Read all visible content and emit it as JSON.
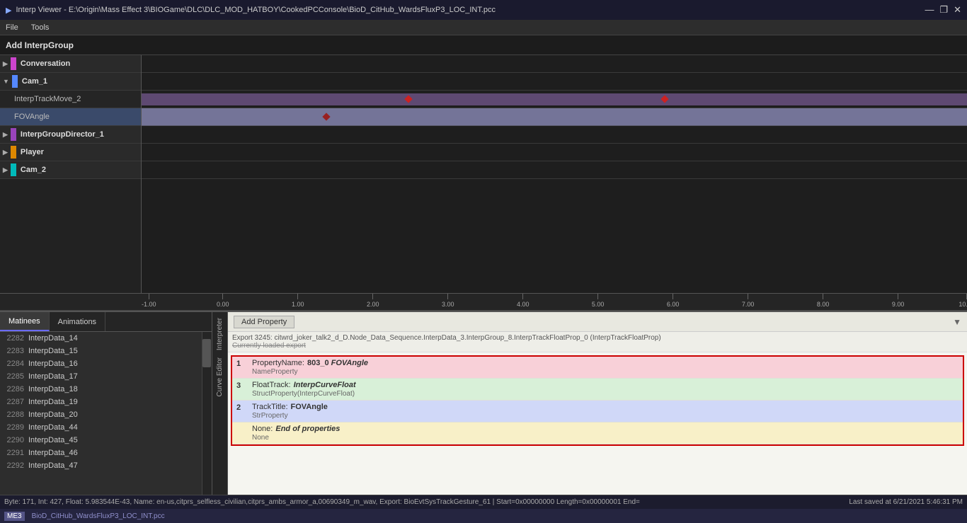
{
  "titlebar": {
    "icon": "▶",
    "title": "Interp Viewer - E:\\Origin\\Mass Effect 3\\BIOGame\\DLC\\DLC_MOD_HATBOY\\CookedPCConsole\\BioD_CitHub_WardsFluxP3_LOC_INT.pcc",
    "minimize": "—",
    "maximize": "❐",
    "close": "✕"
  },
  "menubar": {
    "items": [
      "File",
      "Tools"
    ]
  },
  "addInterpBar": {
    "label": "Add InterpGroup"
  },
  "tracks": [
    {
      "id": "conversation",
      "name": "Conversation",
      "color": "#cc44cc",
      "indent": 0,
      "arrow": "▶",
      "hasBar": false
    },
    {
      "id": "cam1",
      "name": "Cam_1",
      "color": "#5588ff",
      "indent": 0,
      "arrow": "▼",
      "hasBar": false
    },
    {
      "id": "interptrack",
      "name": "InterpTrackMove_2",
      "color": null,
      "indent": 1,
      "arrow": null,
      "hasBar": true,
      "barColor": "#6666aa",
      "keyframes": [
        0.35,
        0.72
      ]
    },
    {
      "id": "fovangle",
      "name": "FOVAngle",
      "color": null,
      "indent": 1,
      "arrow": null,
      "hasBar": true,
      "barColor": "#6666aa",
      "keyframes": [
        0.27
      ]
    },
    {
      "id": "interpgroupdir",
      "name": "InterpGroupDirector_1",
      "color": "#9944bb",
      "indent": 0,
      "arrow": "▶",
      "hasBar": false
    },
    {
      "id": "player",
      "name": "Player",
      "color": "#dd8800",
      "indent": 0,
      "arrow": "▶",
      "hasBar": false
    },
    {
      "id": "cam2",
      "name": "Cam_2",
      "color": "#00bbbb",
      "indent": 0,
      "arrow": "▶",
      "hasBar": false
    }
  ],
  "ruler": {
    "ticks": [
      "-1.00",
      "0.00",
      "1.00",
      "2.00",
      "3.00",
      "4.00",
      "5.00",
      "6.00",
      "7.00",
      "8.00",
      "9.00",
      "10.00"
    ]
  },
  "tabs": {
    "matinees": "Matinees",
    "animations": "Animations"
  },
  "listItems": [
    {
      "num": "2282",
      "name": "InterpData_14"
    },
    {
      "num": "2283",
      "name": "InterpData_15"
    },
    {
      "num": "2284",
      "name": "InterpData_16"
    },
    {
      "num": "2285",
      "name": "InterpData_17"
    },
    {
      "num": "2286",
      "name": "InterpData_18"
    },
    {
      "num": "2287",
      "name": "InterpData_19"
    },
    {
      "num": "2288",
      "name": "InterpData_20"
    },
    {
      "num": "2289",
      "name": "InterpData_44"
    },
    {
      "num": "2290",
      "name": "InterpData_45"
    },
    {
      "num": "2291",
      "name": "InterpData_46"
    },
    {
      "num": "2292",
      "name": "InterpData_47"
    }
  ],
  "verticalTabs": {
    "interpreter": "Interpreter",
    "curveEditor": "Curve Editor"
  },
  "addProperty": {
    "label": "Add Property",
    "dropdownArrow": "▼"
  },
  "exportInfo": {
    "line1": "Export 3245: citwrd_joker_talk2_d_D.Node_Data_Sequence.InterpData_3.InterpGroup_8.InterpTrackFloatProp_0 (InterpTrackFloatProp)",
    "line2": "Currently loaded export"
  },
  "properties": [
    {
      "number": "1",
      "key": "PropertyName:",
      "value": "803_0 FOVAngle",
      "type": "NameProperty",
      "bg": "pink"
    },
    {
      "number": "3",
      "key": "FloatTrack:",
      "value": "InterpCurveFloat",
      "type": "StructProperty(InterpCurveFloat)",
      "bg": "green"
    },
    {
      "number": "2",
      "key": "TrackTitle:",
      "value": "FOVAngle",
      "type": "StrProperty",
      "bg": "blue"
    },
    {
      "number": null,
      "key": "None:",
      "value": "End of properties",
      "type": "None",
      "bg": "yellow",
      "italic": true
    }
  ],
  "statusBar": {
    "left": "Byte: 171, Int: 427, Float: 5.983544E-43, Name: en-us,citprs_selfless_civilian,citprs_ambs_armor_a,00690349_m_wav, Export: BioEvtSysTrackGesture_61 | Start=0x00000000 Length=0x00000001 End=",
    "right": "Last saved at 6/21/2021 5:46:31 PM"
  },
  "footer": {
    "tag": "ME3",
    "filename": "BioD_CitHub_WardsFluxP3_LOC_INT.pcc"
  }
}
